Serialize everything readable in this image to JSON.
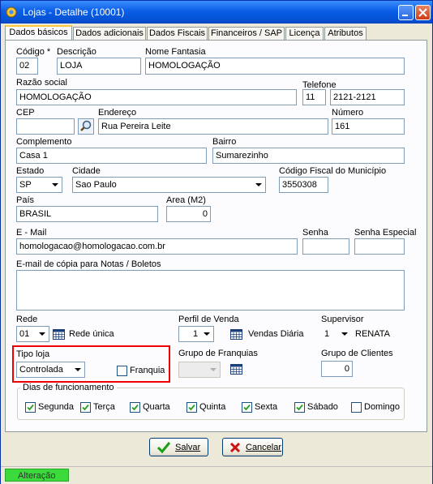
{
  "window": {
    "title": "Lojas - Detalhe (10001)"
  },
  "tabs": [
    "Dados básicos",
    "Dados adicionais",
    "Dados Fiscais",
    "Financeiros / SAP",
    "Licença",
    "Atributos"
  ],
  "form": {
    "codigo": {
      "label": "Código *",
      "value": "02"
    },
    "descricao": {
      "label": "Descrição",
      "value": "LOJA"
    },
    "nome_fantasia": {
      "label": "Nome Fantasia",
      "value": "HOMOLOGAÇÃO"
    },
    "razao_social": {
      "label": "Razão social",
      "value": "HOMOLOGAÇÃO"
    },
    "telefone": {
      "label": "Telefone",
      "ddd": "11",
      "numero": "2121-2121"
    },
    "cep": {
      "label": "CEP",
      "value": ""
    },
    "endereco": {
      "label": "Endereço",
      "value": "Rua Pereira Leite"
    },
    "numero": {
      "label": "Número",
      "value": "161"
    },
    "complemento": {
      "label": "Complemento",
      "value": "Casa 1"
    },
    "bairro": {
      "label": "Bairro",
      "value": "Sumarezinho"
    },
    "estado": {
      "label": "Estado",
      "value": "SP"
    },
    "cidade": {
      "label": "Cidade",
      "value": "Sao Paulo"
    },
    "codigo_fiscal": {
      "label": "Código Fiscal do Município",
      "value": "3550308"
    },
    "pais": {
      "label": "País",
      "value": "BRASIL"
    },
    "area": {
      "label": "Area (M2)",
      "value": "0"
    },
    "email": {
      "label": "E - Mail",
      "value": "homologacao@homologacao.com.br"
    },
    "senha": {
      "label": "Senha",
      "value": ""
    },
    "senha_especial": {
      "label": "Senha Especial",
      "value": ""
    },
    "email_copia": {
      "label": "E-mail de cópia para Notas / Boletos",
      "value": ""
    },
    "rede": {
      "label": "Rede",
      "value": "01",
      "desc": "Rede única"
    },
    "perfil_venda": {
      "label": "Perfil de Venda",
      "value": "1",
      "desc": "Vendas Diária"
    },
    "supervisor": {
      "label": "Supervisor",
      "value": "1",
      "desc": "RENATA"
    },
    "tipo_loja": {
      "label": "Tipo loja",
      "value": "Controlada"
    },
    "franquia": {
      "label": "Franquia",
      "checked": false
    },
    "grupo_franquias": {
      "label": "Grupo de Franquias",
      "value": ""
    },
    "grupo_clientes": {
      "label": "Grupo de Clientes",
      "value": "0"
    }
  },
  "dias": {
    "title": "Dias de funcionamento",
    "items": [
      {
        "label": "Segunda",
        "checked": true
      },
      {
        "label": "Terça",
        "checked": true
      },
      {
        "label": "Quarta",
        "checked": true
      },
      {
        "label": "Quinta",
        "checked": true
      },
      {
        "label": "Sexta",
        "checked": true
      },
      {
        "label": "Sábado",
        "checked": true
      },
      {
        "label": "Domingo",
        "checked": false
      }
    ]
  },
  "buttons": {
    "save": "Salvar",
    "cancel": "Cancelar"
  },
  "status": {
    "text": "Alteração",
    "color": "#3adb3a"
  }
}
